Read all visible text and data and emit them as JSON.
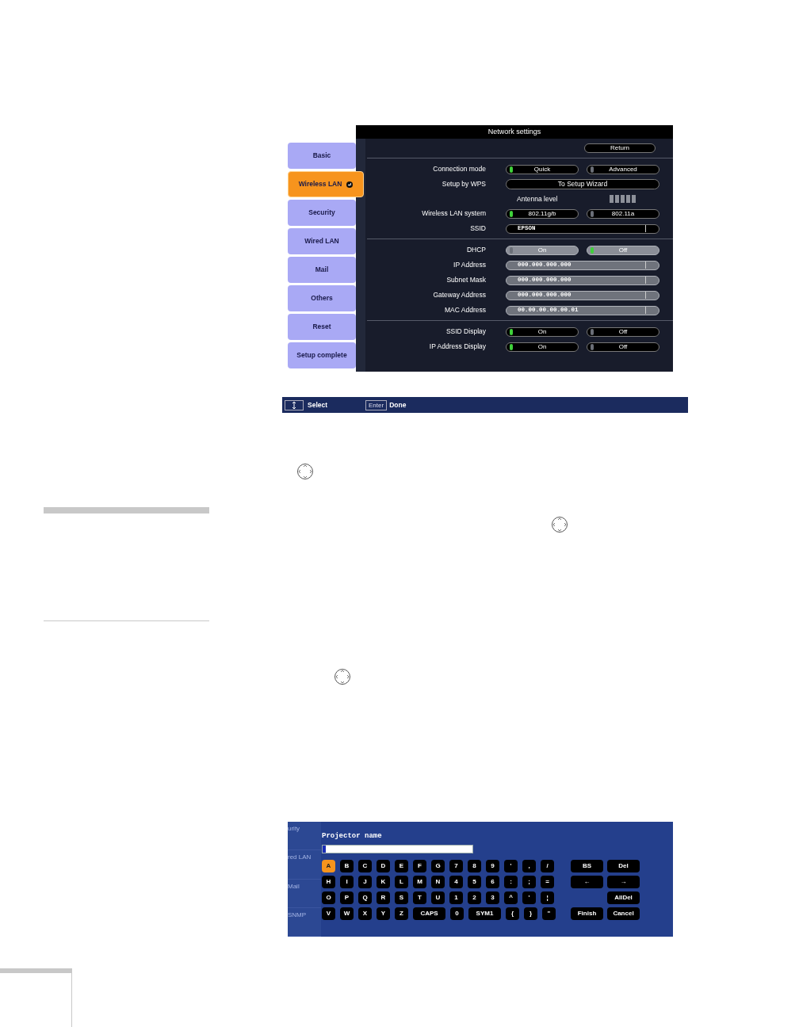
{
  "network_settings": {
    "title": "Network settings",
    "sidebar": [
      {
        "label": "Basic",
        "selected": false
      },
      {
        "label": "Wireless LAN",
        "selected": true
      },
      {
        "label": "Security",
        "selected": false
      },
      {
        "label": "Wired LAN",
        "selected": false
      },
      {
        "label": "Mail",
        "selected": false
      },
      {
        "label": "Others",
        "selected": false
      },
      {
        "label": "Reset",
        "selected": false
      },
      {
        "label": "Setup complete",
        "selected": false
      }
    ],
    "sections": [
      [
        {
          "kind": "return",
          "button": "Return"
        }
      ],
      [
        {
          "kind": "options",
          "label": "Connection mode",
          "shaded": false,
          "options": [
            {
              "label": "Quick",
              "selected": true
            },
            {
              "label": "Advanced",
              "selected": false
            }
          ]
        },
        {
          "kind": "button",
          "label": "Setup by WPS",
          "button": "To Setup Wizard"
        },
        {
          "kind": "antenna",
          "label": "Antenna level"
        },
        {
          "kind": "options",
          "label": "Wireless LAN system",
          "shaded": false,
          "options": [
            {
              "label": "802.11g/b",
              "selected": true
            },
            {
              "label": "802.11a",
              "selected": false
            }
          ]
        },
        {
          "kind": "field",
          "label": "SSID",
          "value": "EPSON",
          "shaded": false
        }
      ],
      [
        {
          "kind": "options",
          "label": "DHCP",
          "shaded": true,
          "options": [
            {
              "label": "On",
              "selected": false
            },
            {
              "label": "Off",
              "selected": true
            }
          ]
        },
        {
          "kind": "field",
          "label": "IP Address",
          "value": "000.000.000.000",
          "shaded": true
        },
        {
          "kind": "field",
          "label": "Subnet Mask",
          "value": "000.000.000.000",
          "shaded": true
        },
        {
          "kind": "field",
          "label": "Gateway Address",
          "value": "000.000.000.000",
          "shaded": true
        },
        {
          "kind": "field",
          "label": "MAC Address",
          "value": "00.00.00.00.00.01",
          "shaded": true
        }
      ],
      [
        {
          "kind": "options",
          "label": "SSID Display",
          "shaded": false,
          "options": [
            {
              "label": "On",
              "selected": true
            },
            {
              "label": "Off",
              "selected": false
            }
          ]
        },
        {
          "kind": "options",
          "label": "IP Address Display",
          "shaded": false,
          "options": [
            {
              "label": "On",
              "selected": true
            },
            {
              "label": "Off",
              "selected": false
            }
          ]
        }
      ]
    ]
  },
  "help_bar": [
    {
      "kind": "arrows",
      "label": "Select"
    },
    {
      "kind": "key",
      "key": "Enter",
      "label": "Done"
    }
  ],
  "keyboard": {
    "sidebar": [
      "urity",
      "red LAN",
      "Mail",
      "SNMP"
    ],
    "title": "Projector name",
    "keys": [
      [
        {
          "label": "A",
          "selected": true
        },
        {
          "label": "B",
          "selected": false
        },
        {
          "label": "C",
          "selected": false
        },
        {
          "label": "D",
          "selected": false
        },
        {
          "label": "E",
          "selected": false
        },
        {
          "label": "F",
          "selected": false
        },
        {
          "label": "G",
          "selected": false
        },
        {
          "label": "7",
          "selected": false
        },
        {
          "label": "8",
          "selected": false
        },
        {
          "label": "9",
          "selected": false
        },
        {
          "label": "'",
          "selected": false
        },
        {
          "label": ",",
          "selected": false
        },
        {
          "label": "/",
          "selected": false
        }
      ],
      [
        {
          "label": "H",
          "selected": false
        },
        {
          "label": "I",
          "selected": false
        },
        {
          "label": "J",
          "selected": false
        },
        {
          "label": "K",
          "selected": false
        },
        {
          "label": "L",
          "selected": false
        },
        {
          "label": "M",
          "selected": false
        },
        {
          "label": "N",
          "selected": false
        },
        {
          "label": "4",
          "selected": false
        },
        {
          "label": "5",
          "selected": false
        },
        {
          "label": "6",
          "selected": false
        },
        {
          "label": ":",
          "selected": false
        },
        {
          "label": ";",
          "selected": false
        },
        {
          "label": "=",
          "selected": false
        }
      ],
      [
        {
          "label": "O",
          "selected": false
        },
        {
          "label": "P",
          "selected": false
        },
        {
          "label": "Q",
          "selected": false
        },
        {
          "label": "R",
          "selected": false
        },
        {
          "label": "S",
          "selected": false
        },
        {
          "label": "T",
          "selected": false
        },
        {
          "label": "U",
          "selected": false
        },
        {
          "label": "1",
          "selected": false
        },
        {
          "label": "2",
          "selected": false
        },
        {
          "label": "3",
          "selected": false
        },
        {
          "label": "^",
          "selected": false
        },
        {
          "label": "'",
          "selected": false
        },
        {
          "label": "¦",
          "selected": false
        }
      ],
      [
        {
          "label": "V",
          "selected": false
        },
        {
          "label": "W",
          "selected": false
        },
        {
          "label": "X",
          "selected": false
        },
        {
          "label": "Y",
          "selected": false
        },
        {
          "label": "Z",
          "selected": false
        },
        {
          "label": "CAPS",
          "selected": false,
          "wide": true
        },
        {
          "label": "0",
          "selected": false
        },
        {
          "label": "SYM1",
          "selected": false,
          "wide": true
        },
        {
          "label": "{",
          "selected": false
        },
        {
          "label": "}",
          "selected": false
        },
        {
          "label": "\"",
          "selected": false
        }
      ]
    ],
    "edit_keys": [
      [
        {
          "kind": "key",
          "label": "BS"
        },
        {
          "kind": "key",
          "label": "Del"
        }
      ],
      [
        {
          "kind": "key",
          "label": "←"
        },
        {
          "kind": "key",
          "label": "→"
        }
      ],
      [
        {
          "kind": "gap"
        },
        {
          "kind": "key",
          "label": "AllDel"
        }
      ],
      [
        {
          "kind": "key",
          "label": "Finish"
        },
        {
          "kind": "key",
          "label": "Cancel"
        }
      ]
    ]
  }
}
